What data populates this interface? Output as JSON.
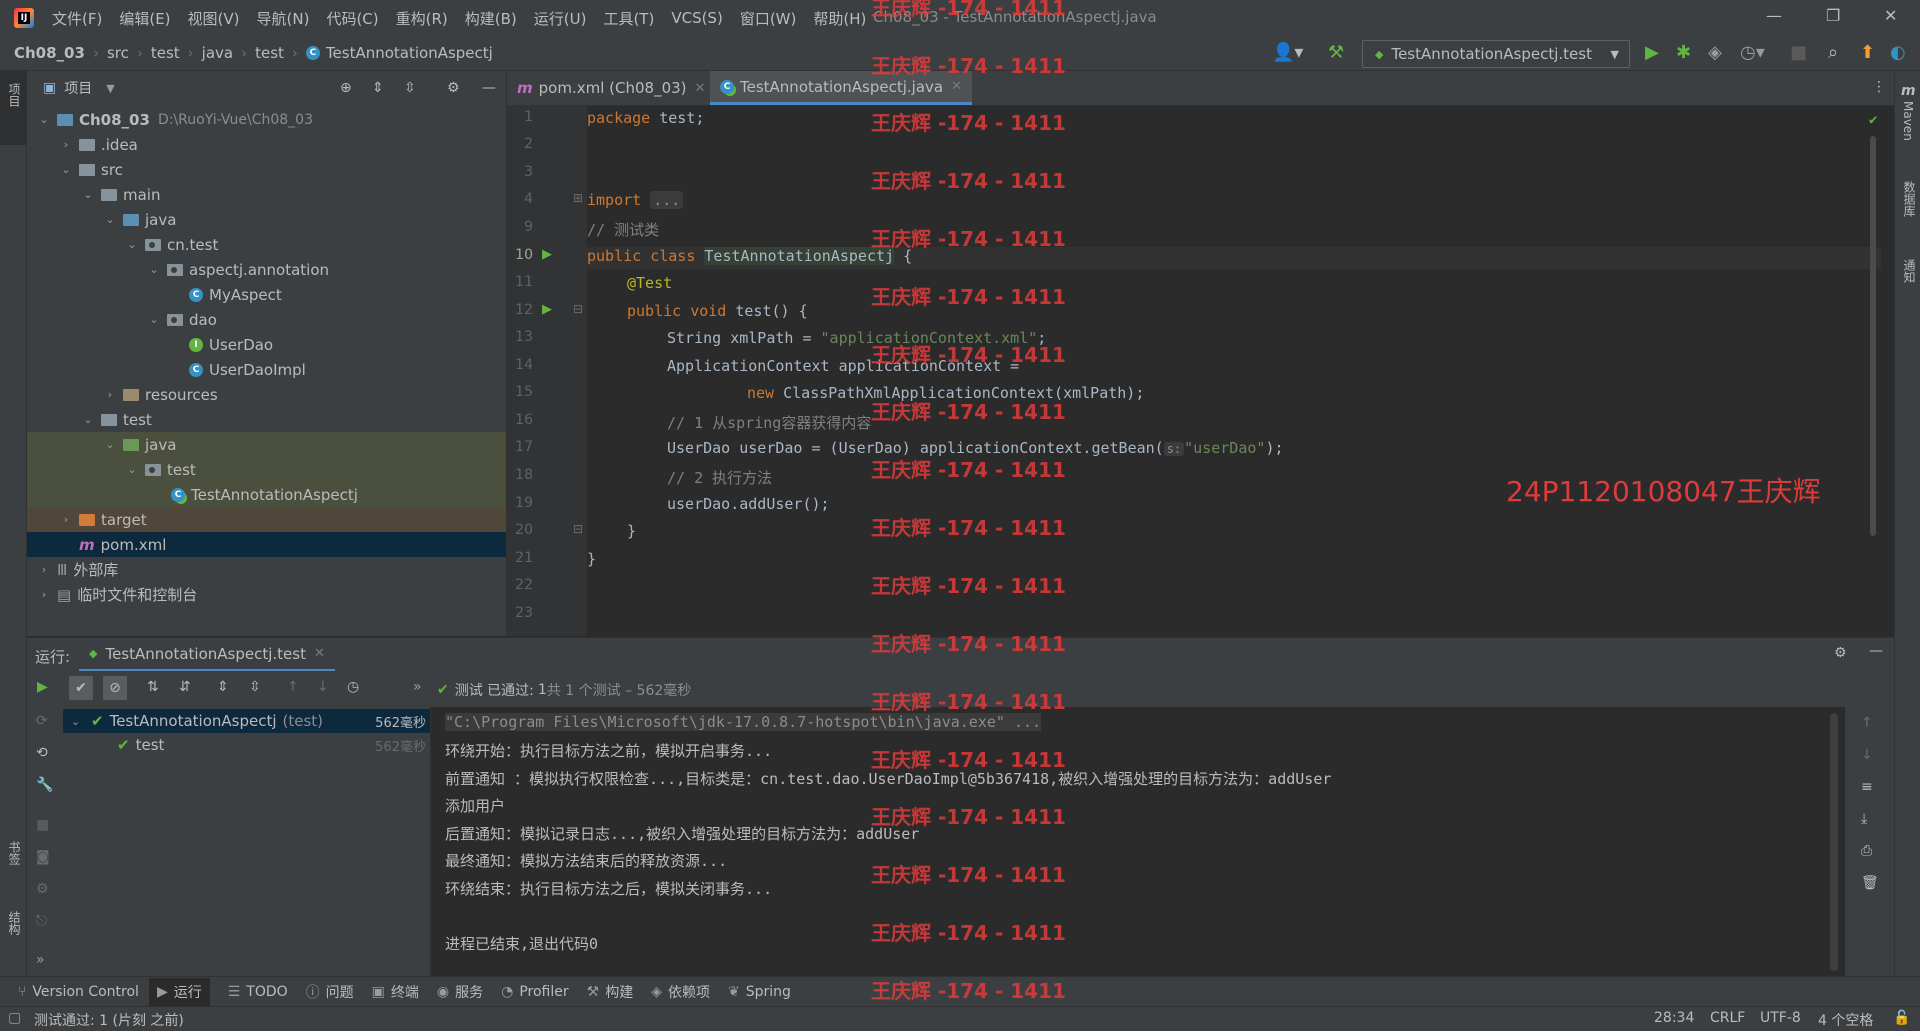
{
  "app": {
    "menu": [
      "文件(F)",
      "编辑(E)",
      "视图(V)",
      "导航(N)",
      "代码(C)",
      "重构(R)",
      "构建(B)",
      "运行(U)",
      "工具(T)",
      "VCS(S)",
      "窗口(W)",
      "帮助(H)"
    ],
    "window_title": "Ch08_03 - TestAnnotationAspectj.java"
  },
  "breadcrumb": [
    "Ch08_03",
    "src",
    "test",
    "java",
    "test",
    "TestAnnotationAspectj"
  ],
  "run_config": "TestAnnotationAspectj.test",
  "left_stripe": {
    "project": "项目",
    "bookmarks": "书签",
    "structure": "结构"
  },
  "right_stripe": {
    "maven": "Maven",
    "database": "数据库",
    "notifications": "通知"
  },
  "project_panel": {
    "title": "项目",
    "tree": [
      {
        "label": "Ch08_03",
        "path": "D:\\RuoYi-Vue\\Ch08_03"
      },
      {
        "label": ".idea"
      },
      {
        "label": "src"
      },
      {
        "label": "main"
      },
      {
        "label": "java"
      },
      {
        "label": "cn.test"
      },
      {
        "label": "aspectj.annotation"
      },
      {
        "label": "MyAspect"
      },
      {
        "label": "dao"
      },
      {
        "label": "UserDao"
      },
      {
        "label": "UserDaoImpl"
      },
      {
        "label": "resources"
      },
      {
        "label": "test"
      },
      {
        "label": "java"
      },
      {
        "label": "test"
      },
      {
        "label": "TestAnnotationAspectj"
      },
      {
        "label": "target"
      },
      {
        "label": "pom.xml"
      },
      {
        "label": "外部库"
      },
      {
        "label": "临时文件和控制台"
      }
    ]
  },
  "editor": {
    "tabs": [
      "pom.xml (Ch08_03)",
      "TestAnnotationAspectj.java"
    ],
    "line_numbers": [
      "1",
      "2",
      "3",
      "4",
      "9",
      "10",
      "11",
      "12",
      "13",
      "14",
      "15",
      "16",
      "17",
      "18",
      "19",
      "20",
      "21",
      "22",
      "23"
    ],
    "code": {
      "l1_kw": "package",
      "l1_rest": " test;",
      "l4_kw": "import",
      "l4_fold": "...",
      "l9": "// 测试类",
      "l10_kw": "public class",
      "l10_name": "TestAnnotationAspectj",
      "l10_rest": " {",
      "l11": "@Test",
      "l12_kw": "public void",
      "l12_rest": " test() {",
      "l13_a": "String xmlPath = ",
      "l13_str": "\"applicationContext.xml\"",
      "l13_b": ";",
      "l14": "ApplicationContext applicationContext =",
      "l15_kw": "new",
      "l15_rest": " ClassPathXmlApplicationContext(xmlPath);",
      "l16": "// 1 从spring容器获得内容",
      "l17_a": "UserDao userDao = (UserDao) applicationContext.getBean(",
      "l17_hint": "s:",
      "l17_str": "\"userDao\"",
      "l17_b": ");",
      "l18": "// 2 执行方法",
      "l19": "userDao.addUser();",
      "l20": "}",
      "l21": "}"
    }
  },
  "run_panel": {
    "label": "运行:",
    "tab": "TestAnnotationAspectj.test",
    "status_prefix": "测试 已通过:",
    "status_count": "1",
    "status_rest": "共 1 个测试 – 562毫秒",
    "tests": [
      {
        "name": "TestAnnotationAspectj",
        "suffix": "(test)",
        "time": "562毫秒"
      },
      {
        "name": "test",
        "suffix": "",
        "time": "562毫秒"
      }
    ],
    "console": [
      "\"C:\\Program Files\\Microsoft\\jdk-17.0.8.7-hotspot\\bin\\java.exe\" ...",
      "环绕开始：执行目标方法之前，模拟开启事务...",
      "前置通知 ：模拟执行权限检查...,目标类是：cn.test.dao.UserDaoImpl@5b367418,被织入增强处理的目标方法为：addUser",
      "添加用户",
      "后置通知：模拟记录日志...,被织入增强处理的目标方法为：addUser",
      "最终通知：模拟方法结束后的释放资源...",
      "环绕结束：执行目标方法之后，模拟关闭事务...",
      "",
      "进程已结束,退出代码0"
    ]
  },
  "bottom_tools": [
    "Version Control",
    "运行",
    "TODO",
    "问题",
    "终端",
    "服务",
    "Profiler",
    "构建",
    "依赖项",
    "Spring"
  ],
  "status_bar": {
    "left": "测试通过: 1 (片刻 之前)",
    "position": "28:34",
    "line_sep": "CRLF",
    "encoding": "UTF-8",
    "indent": "4 个空格"
  },
  "watermark": {
    "repeat": "王庆辉 -174 - 1411",
    "big": "24P1120108047王庆辉"
  },
  "colors": {
    "background": "#2b2b2b",
    "panel": "#3c3f41",
    "keyword": "#cc7832",
    "string": "#6a8759",
    "annotation": "#bbb529",
    "comment": "#808080",
    "pass_green": "#62b543",
    "watermark_red": "#e03b3b"
  }
}
